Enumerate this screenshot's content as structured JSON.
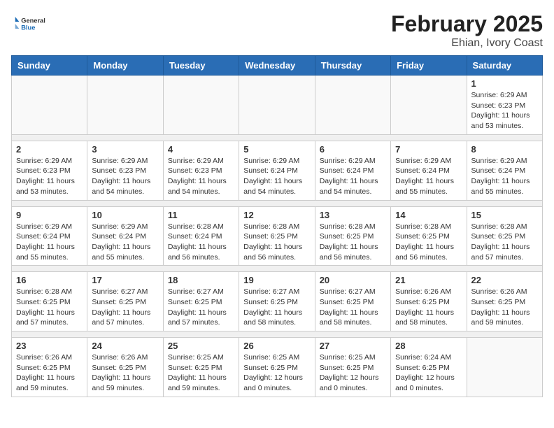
{
  "header": {
    "logo_general": "General",
    "logo_blue": "Blue",
    "month_title": "February 2025",
    "location": "Ehian, Ivory Coast"
  },
  "weekdays": [
    "Sunday",
    "Monday",
    "Tuesday",
    "Wednesday",
    "Thursday",
    "Friday",
    "Saturday"
  ],
  "weeks": [
    [
      {
        "day": "",
        "info": ""
      },
      {
        "day": "",
        "info": ""
      },
      {
        "day": "",
        "info": ""
      },
      {
        "day": "",
        "info": ""
      },
      {
        "day": "",
        "info": ""
      },
      {
        "day": "",
        "info": ""
      },
      {
        "day": "1",
        "info": "Sunrise: 6:29 AM\nSunset: 6:23 PM\nDaylight: 11 hours\nand 53 minutes."
      }
    ],
    [
      {
        "day": "2",
        "info": "Sunrise: 6:29 AM\nSunset: 6:23 PM\nDaylight: 11 hours\nand 53 minutes."
      },
      {
        "day": "3",
        "info": "Sunrise: 6:29 AM\nSunset: 6:23 PM\nDaylight: 11 hours\nand 54 minutes."
      },
      {
        "day": "4",
        "info": "Sunrise: 6:29 AM\nSunset: 6:23 PM\nDaylight: 11 hours\nand 54 minutes."
      },
      {
        "day": "5",
        "info": "Sunrise: 6:29 AM\nSunset: 6:24 PM\nDaylight: 11 hours\nand 54 minutes."
      },
      {
        "day": "6",
        "info": "Sunrise: 6:29 AM\nSunset: 6:24 PM\nDaylight: 11 hours\nand 54 minutes."
      },
      {
        "day": "7",
        "info": "Sunrise: 6:29 AM\nSunset: 6:24 PM\nDaylight: 11 hours\nand 55 minutes."
      },
      {
        "day": "8",
        "info": "Sunrise: 6:29 AM\nSunset: 6:24 PM\nDaylight: 11 hours\nand 55 minutes."
      }
    ],
    [
      {
        "day": "9",
        "info": "Sunrise: 6:29 AM\nSunset: 6:24 PM\nDaylight: 11 hours\nand 55 minutes."
      },
      {
        "day": "10",
        "info": "Sunrise: 6:29 AM\nSunset: 6:24 PM\nDaylight: 11 hours\nand 55 minutes."
      },
      {
        "day": "11",
        "info": "Sunrise: 6:28 AM\nSunset: 6:24 PM\nDaylight: 11 hours\nand 56 minutes."
      },
      {
        "day": "12",
        "info": "Sunrise: 6:28 AM\nSunset: 6:25 PM\nDaylight: 11 hours\nand 56 minutes."
      },
      {
        "day": "13",
        "info": "Sunrise: 6:28 AM\nSunset: 6:25 PM\nDaylight: 11 hours\nand 56 minutes."
      },
      {
        "day": "14",
        "info": "Sunrise: 6:28 AM\nSunset: 6:25 PM\nDaylight: 11 hours\nand 56 minutes."
      },
      {
        "day": "15",
        "info": "Sunrise: 6:28 AM\nSunset: 6:25 PM\nDaylight: 11 hours\nand 57 minutes."
      }
    ],
    [
      {
        "day": "16",
        "info": "Sunrise: 6:28 AM\nSunset: 6:25 PM\nDaylight: 11 hours\nand 57 minutes."
      },
      {
        "day": "17",
        "info": "Sunrise: 6:27 AM\nSunset: 6:25 PM\nDaylight: 11 hours\nand 57 minutes."
      },
      {
        "day": "18",
        "info": "Sunrise: 6:27 AM\nSunset: 6:25 PM\nDaylight: 11 hours\nand 57 minutes."
      },
      {
        "day": "19",
        "info": "Sunrise: 6:27 AM\nSunset: 6:25 PM\nDaylight: 11 hours\nand 58 minutes."
      },
      {
        "day": "20",
        "info": "Sunrise: 6:27 AM\nSunset: 6:25 PM\nDaylight: 11 hours\nand 58 minutes."
      },
      {
        "day": "21",
        "info": "Sunrise: 6:26 AM\nSunset: 6:25 PM\nDaylight: 11 hours\nand 58 minutes."
      },
      {
        "day": "22",
        "info": "Sunrise: 6:26 AM\nSunset: 6:25 PM\nDaylight: 11 hours\nand 59 minutes."
      }
    ],
    [
      {
        "day": "23",
        "info": "Sunrise: 6:26 AM\nSunset: 6:25 PM\nDaylight: 11 hours\nand 59 minutes."
      },
      {
        "day": "24",
        "info": "Sunrise: 6:26 AM\nSunset: 6:25 PM\nDaylight: 11 hours\nand 59 minutes."
      },
      {
        "day": "25",
        "info": "Sunrise: 6:25 AM\nSunset: 6:25 PM\nDaylight: 11 hours\nand 59 minutes."
      },
      {
        "day": "26",
        "info": "Sunrise: 6:25 AM\nSunset: 6:25 PM\nDaylight: 12 hours\nand 0 minutes."
      },
      {
        "day": "27",
        "info": "Sunrise: 6:25 AM\nSunset: 6:25 PM\nDaylight: 12 hours\nand 0 minutes."
      },
      {
        "day": "28",
        "info": "Sunrise: 6:24 AM\nSunset: 6:25 PM\nDaylight: 12 hours\nand 0 minutes."
      },
      {
        "day": "",
        "info": ""
      }
    ]
  ]
}
